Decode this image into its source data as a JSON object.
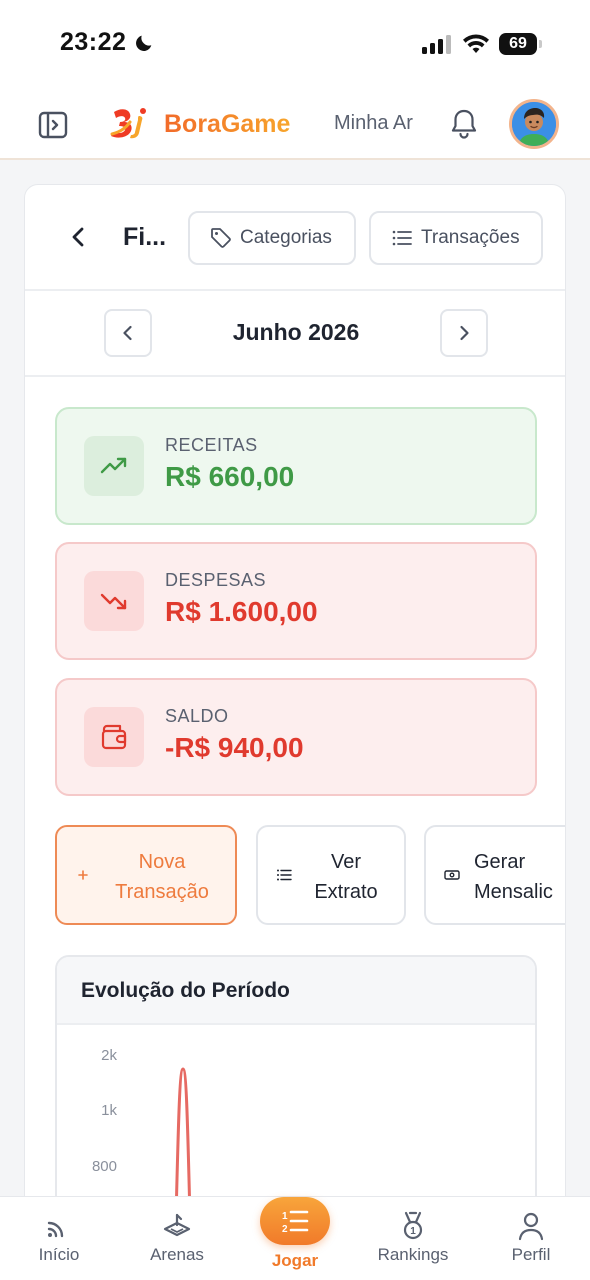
{
  "status_bar": {
    "time": "23:22",
    "battery": "69"
  },
  "header": {
    "logo_text": "BoraGame",
    "link": "Minha Ar"
  },
  "toolbar": {
    "title": "Fi...",
    "categorias_label": "Categorias",
    "transacoes_label": "Transações"
  },
  "month_nav": {
    "label": "Junho 2026"
  },
  "stats": {
    "receitas": {
      "label": "RECEITAS",
      "value": "R$ 660,00"
    },
    "despesas": {
      "label": "DESPESAS",
      "value": "R$ 1.600,00"
    },
    "saldo": {
      "label": "SALDO",
      "value": "-R$ 940,00"
    }
  },
  "actions": {
    "nova_line1": "Nova",
    "nova_line2": "Transação",
    "extrato_line1": "Ver",
    "extrato_line2": "Extrato",
    "gerar_line1": "Gerar",
    "gerar_line2": "Mensalic"
  },
  "chart": {
    "title": "Evolução do Período"
  },
  "chart_data": {
    "type": "line",
    "title": "Evolução do Período",
    "y_ticks": [
      "2k",
      "1k",
      "800"
    ],
    "series": [
      {
        "color": "#e66a63",
        "values": [
          0,
          1800,
          0
        ]
      }
    ]
  },
  "bottom_nav": {
    "inicio": "Início",
    "arenas": "Arenas",
    "jogar": "Jogar",
    "rankings": "Rankings",
    "perfil": "Perfil"
  },
  "colors": {
    "accent": "#f17a2a",
    "income": "#3f9a46",
    "expense": "#e03a2e"
  }
}
